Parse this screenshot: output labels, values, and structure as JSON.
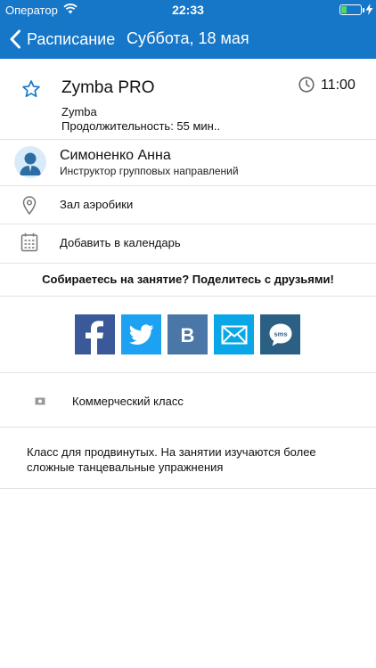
{
  "status_bar": {
    "carrier": "Оператор",
    "time": "22:33"
  },
  "nav": {
    "back_label": "Расписание",
    "title": "Суббота, 18 мая"
  },
  "class": {
    "title": "Zymba PRO",
    "time": "11:00",
    "brand": "Zymba",
    "duration": "Продолжительность: 55 мин.."
  },
  "instructor": {
    "name": "Симоненко Анна",
    "role": "Инструктор групповых направлений"
  },
  "location": {
    "label": "Зал аэробики"
  },
  "calendar": {
    "label": "Добавить в календарь"
  },
  "share": {
    "question": "Собираетесь на занятие? Поделитесь с друзьями!",
    "buttons": [
      {
        "name": "facebook",
        "color": "#3b5998"
      },
      {
        "name": "twitter",
        "color": "#1da1f2"
      },
      {
        "name": "vk",
        "color": "#4a76a8"
      },
      {
        "name": "email",
        "color": "#0aa7e8"
      },
      {
        "name": "sms",
        "color": "#2b5f84"
      }
    ]
  },
  "commercial": {
    "label": "Коммерческий класс"
  },
  "description": "Класс для продвинутых. На занятии изучаются более сложные танцевальные упражнения",
  "colors": {
    "header": "#1676c8",
    "accent": "#1676c8",
    "divider": "#e3e3e3"
  }
}
